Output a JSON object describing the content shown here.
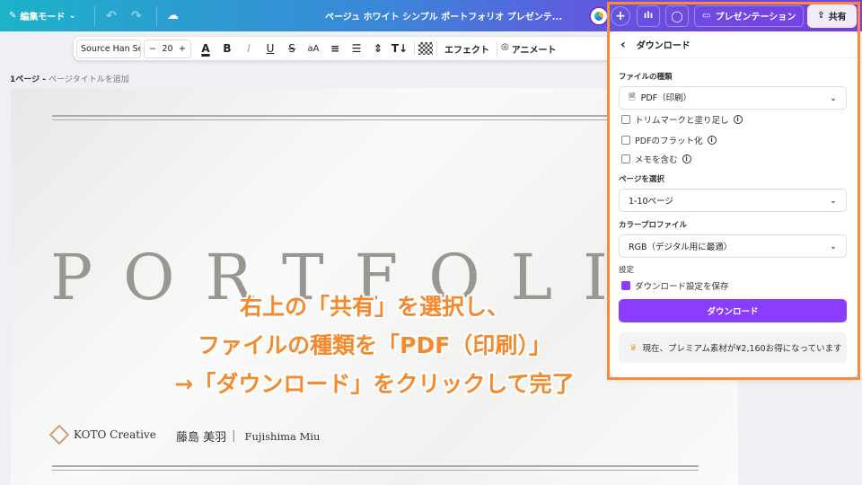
{
  "topbar": {
    "mode_label": "編集モード",
    "title": "ページュ ホワイト シンプル ポートフォリオ プレゼンテ...",
    "present_label": "プレゼンテーション",
    "share_label": "共有"
  },
  "toolbar": {
    "font": "Source Han Serif ...",
    "minus": "−",
    "size": "20",
    "plus": "+",
    "case": "aA",
    "effects": "エフェクト",
    "animate": "アニメート"
  },
  "page": {
    "number": "1ページ - ",
    "title_placeholder": "ページタイトルを追加"
  },
  "design": {
    "title": "PORTFOLIO",
    "brand": "KOTO Creative",
    "name_jp": "藤島 美羽",
    "divider": "|",
    "name_en": "Fujishima Miu"
  },
  "overlay": {
    "lines": [
      "右上の「共有」を選択し、",
      "ファイルの種類を「PDF（印刷）」",
      "→「ダウンロード」をクリックして完了"
    ],
    "color": "#f5892e"
  },
  "panel": {
    "back": "‹",
    "title": "ダウンロード",
    "file_type_label": "ファイルの種類",
    "file_type": "PDF（印刷）",
    "options": [
      {
        "label": "トリムマークと塗り足し",
        "checked": false
      },
      {
        "label": "PDFのフラット化",
        "checked": false
      },
      {
        "label": "メモを含む",
        "checked": false
      }
    ],
    "pages_label": "ページを選択",
    "pages": "1-10ページ",
    "color_label": "カラープロファイル",
    "color_profile": "RGB（デジタル用に最適）",
    "settings_label": "設定",
    "save_settings": "ダウンロード設定を保存",
    "save_settings_checked": true,
    "download_button": "ダウンロード",
    "promo": "現在、プレミアム素材が¥2,160お得になっています",
    "accent": "#8b3dff",
    "highlight": "#f98a3c"
  }
}
